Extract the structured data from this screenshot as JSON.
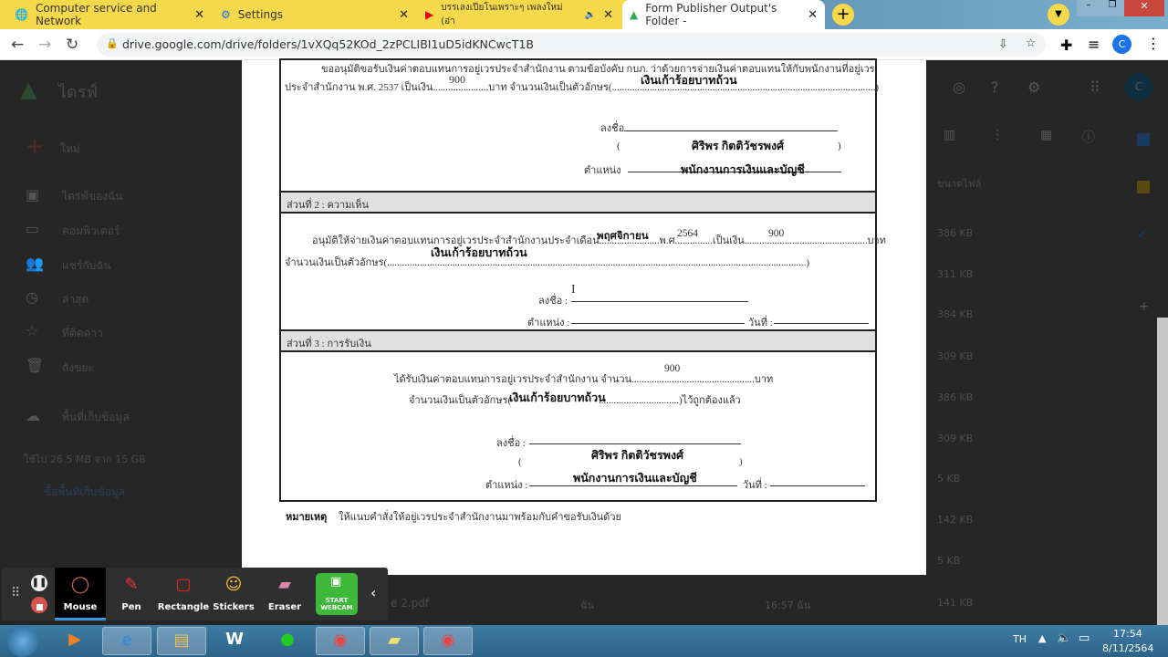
{
  "browser": {
    "tabs": [
      {
        "title": "Computer service and Network",
        "icon": "globe-icon"
      },
      {
        "title": "Settings",
        "icon": "gear-icon"
      },
      {
        "title": "บรรเลงเปียโนเพราะๆ เพลงใหม่ (อ่า",
        "icon": "youtube-icon"
      },
      {
        "title": "Form Publisher Output's Folder -",
        "icon": "google-drive-icon",
        "active": true
      }
    ],
    "url": "drive.google.com/drive/folders/1vXQq52KOd_2zPCLIBI1uD5idKNCwcT1B",
    "profile_initial": "C"
  },
  "drive": {
    "app_name": "ไดรฟ์",
    "new_label": "ใหม่",
    "nav": [
      {
        "label": "ไดรฟ์ของฉัน",
        "icon": "my-drive-icon"
      },
      {
        "label": "คอมพิวเตอร์",
        "icon": "computer-icon"
      },
      {
        "label": "แชร์กับฉัน",
        "icon": "shared-icon"
      },
      {
        "label": "ล่าสุด",
        "icon": "clock-icon"
      },
      {
        "label": "ที่ติดดาว",
        "icon": "star-icon"
      },
      {
        "label": "ถังขยะ",
        "icon": "trash-icon"
      }
    ],
    "storage_label": "พื้นที่เก็บข้อมูล",
    "storage_used": "ใช้ไป 26.5 MB จาก 15 GB",
    "buy_storage": "ซื้อพื้นที่เก็บข้อมูล",
    "size_header": "ขนาดไฟล์",
    "sizes": [
      "386 KB",
      "311 KB",
      "384 KB",
      "309 KB",
      "386 KB",
      "309 KB",
      "5 KB",
      "142 KB",
      "5 KB",
      "141 KB"
    ],
    "file_partial": "e 2.pdf",
    "owner_partial": "ฉัน",
    "time_partial": "16:57 ฉัน"
  },
  "document": {
    "s1_line1": "ขออนุมัติขอรับเงินค่าตอบแทนการอยู่เวรประจำสำนักงาน ตามข้อบังคับ กบภ. ว่าด้วยการจ่ายเงินค่าตอบแทนให้กับพนักงานที่อยู่เวร",
    "s1_line2a": "ประจำสำนักงาน พ.ศ. 2537  เป็นเงิน..........",
    "s1_line2b": "...............บาท จำนวนเงินเป็นตัวอักษร(.........................................................................................................)",
    "amount": "900",
    "amount_words": "เงินเก้าร้อยบาทถ้วน",
    "sign_label": "ลงชื่อ",
    "name": "ศิริพร กิตติวัชรพงศ์",
    "open_paren": "(",
    "close_paren": ")",
    "position_label": "ตำแหน่ง",
    "position": "พนักงานการเงินและบัญชี",
    "s2_header": "ส่วนที่ 2 : ความเห็น",
    "s2_line1a": "อนุมัติให้จ่ายเงินค่าตอบแทนการอยู่เวรประจำสำนักงานประจำเดือน........................พ.ศ...............เป็นเงิน.................................................บาท",
    "month": "พฤศจิกายน",
    "year": "2564",
    "s2_line2": "จำนวนเงินเป็นตัวอักษร(.......................................................................................................................................................................)",
    "sign_label_colon": "ลงชื่อ :",
    "position_label_colon": "ตำแหน่ง :",
    "date_label": "วันที่ :",
    "s3_header": "ส่วนที่ 3 : การรับเงิน",
    "s3_line1": "ได้รับเงินค่าตอบแทนการอยู่เวรประจำสำนักงาน จำนวน.................................................บาท",
    "s3_line2a": "จำนวนเงินเป็นตัวอักษร(",
    "s3_line2b": "................................)ไว้ถูกต้องแล้ว",
    "note_label": "หมายเหตุ",
    "note_text": "ให้แนบคำสั่งให้อยู่เวรประจำสำนักงานมาพร้อมกับคำขอรับเงินด้วย"
  },
  "recorder": {
    "tools": [
      {
        "label": "Mouse",
        "icon": "mouse-cursor-icon",
        "active": true
      },
      {
        "label": "Pen",
        "icon": "pen-icon"
      },
      {
        "label": "Rectangle",
        "icon": "rectangle-icon"
      },
      {
        "label": "Stickers",
        "icon": "sticker-icon"
      },
      {
        "label": "Eraser",
        "icon": "eraser-icon"
      }
    ],
    "webcam_label": "START WEBCAM"
  },
  "taskbar": {
    "language": "TH",
    "time": "17:54",
    "date": "8/11/2564"
  },
  "colors": {
    "tab_bar": "#f6d94a",
    "accent_blue": "#1a73e8",
    "webcam_green": "#3db83a"
  }
}
